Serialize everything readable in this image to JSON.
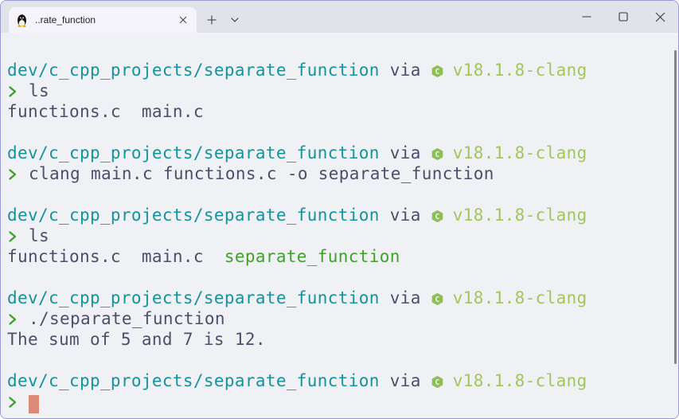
{
  "titlebar": {
    "tab": {
      "title": "..rate_function"
    },
    "icons": [
      "linux-tux-icon",
      "tab-close-icon",
      "new-tab-plus-icon",
      "chevron-down-icon",
      "minimize-icon",
      "maximize-icon",
      "close-icon"
    ]
  },
  "colors": {
    "window_border": "#9b9bd3",
    "titlebar_bg": "#e2e2eb",
    "tab_bg": "#f4f4fa",
    "terminal_bg": "#eff1f5",
    "foreground": "#4c4f69",
    "path_teal": "#179299",
    "success_green": "#40a02b",
    "version_green": "#a2c65b",
    "c_logo_green": "#8cc152",
    "cursor": "#dc8a78",
    "scrollbar": "#84848e"
  },
  "terminal": {
    "lines": [
      {
        "segments": [
          {
            "style": "path",
            "text": "dev/c_cpp_projects/separate_function"
          },
          {
            "style": "fg",
            "text": " via "
          },
          {
            "icon": "c-logo"
          },
          {
            "style": "version",
            "text": " v18.1.8-clang"
          }
        ]
      },
      {
        "segments": [
          {
            "icon": "prompt-chevron"
          },
          {
            "style": "fg",
            "text": " ls"
          }
        ]
      },
      {
        "segments": [
          {
            "style": "fg",
            "text": "functions.c  main.c"
          }
        ]
      },
      {
        "segments": []
      },
      {
        "segments": [
          {
            "style": "path",
            "text": "dev/c_cpp_projects/separate_function"
          },
          {
            "style": "fg",
            "text": " via "
          },
          {
            "icon": "c-logo"
          },
          {
            "style": "version",
            "text": " v18.1.8-clang"
          }
        ]
      },
      {
        "segments": [
          {
            "icon": "prompt-chevron"
          },
          {
            "style": "fg",
            "text": " clang main.c functions.c -o separate_function"
          }
        ]
      },
      {
        "segments": []
      },
      {
        "segments": [
          {
            "style": "path",
            "text": "dev/c_cpp_projects/separate_function"
          },
          {
            "style": "fg",
            "text": " via "
          },
          {
            "icon": "c-logo"
          },
          {
            "style": "version",
            "text": " v18.1.8-clang"
          }
        ]
      },
      {
        "segments": [
          {
            "icon": "prompt-chevron"
          },
          {
            "style": "fg",
            "text": " ls"
          }
        ]
      },
      {
        "segments": [
          {
            "style": "fg",
            "text": "functions.c  main.c  "
          },
          {
            "style": "exec",
            "text": "separate_function"
          }
        ]
      },
      {
        "segments": []
      },
      {
        "segments": [
          {
            "style": "path",
            "text": "dev/c_cpp_projects/separate_function"
          },
          {
            "style": "fg",
            "text": " via "
          },
          {
            "icon": "c-logo"
          },
          {
            "style": "version",
            "text": " v18.1.8-clang"
          }
        ]
      },
      {
        "segments": [
          {
            "icon": "prompt-chevron"
          },
          {
            "style": "fg",
            "text": " ./separate_function"
          }
        ]
      },
      {
        "segments": [
          {
            "style": "fg",
            "text": "The sum of 5 and 7 is 12."
          }
        ]
      },
      {
        "segments": []
      },
      {
        "segments": [
          {
            "style": "path",
            "text": "dev/c_cpp_projects/separate_function"
          },
          {
            "style": "fg",
            "text": " via "
          },
          {
            "icon": "c-logo"
          },
          {
            "style": "version",
            "text": " v18.1.8-clang"
          }
        ]
      },
      {
        "segments": [
          {
            "icon": "prompt-chevron"
          },
          {
            "style": "fg",
            "text": " "
          },
          {
            "icon": "cursor"
          }
        ]
      }
    ]
  }
}
